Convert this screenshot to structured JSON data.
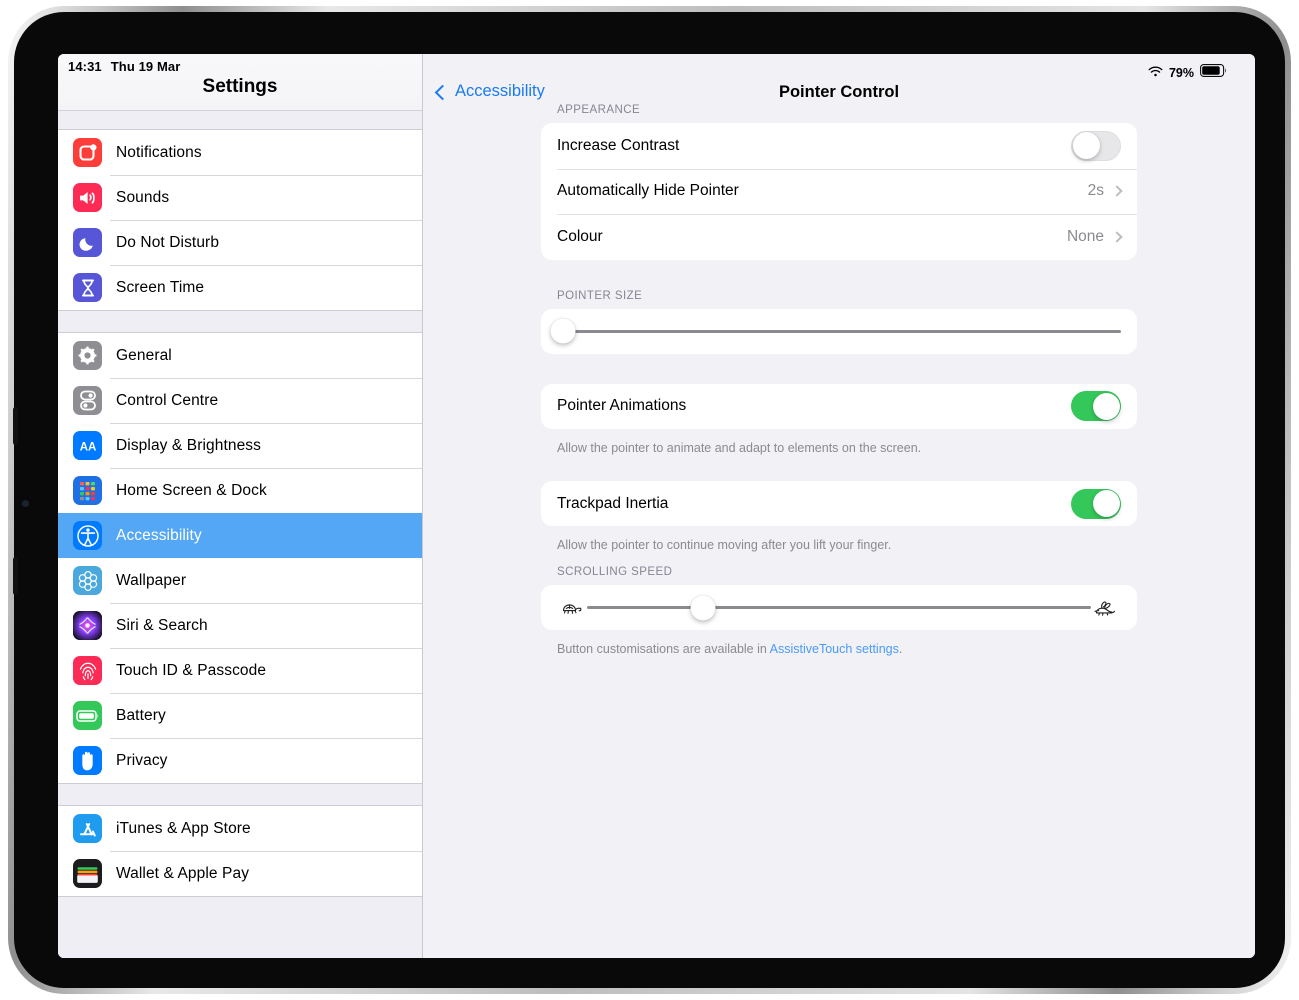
{
  "status_bar": {
    "time": "14:31",
    "date": "Thu 19 Mar",
    "battery_percent": "79%",
    "wifi_icon": "wifi-icon",
    "battery_icon": "battery-icon"
  },
  "sidebar": {
    "title": "Settings",
    "groups": [
      {
        "items": [
          {
            "label": "Notifications",
            "icon": "notifications-icon",
            "color": "#fc3d39",
            "selected": false
          },
          {
            "label": "Sounds",
            "icon": "sounds-icon",
            "color": "#fc2b55",
            "selected": false
          },
          {
            "label": "Do Not Disturb",
            "icon": "do-not-disturb-icon",
            "color": "#5756d6",
            "selected": false
          },
          {
            "label": "Screen Time",
            "icon": "screen-time-icon",
            "color": "#5756d6",
            "selected": false
          }
        ]
      },
      {
        "items": [
          {
            "label": "General",
            "icon": "general-gear-icon",
            "color": "#8e8e93",
            "selected": false
          },
          {
            "label": "Control Centre",
            "icon": "control-centre-icon",
            "color": "#8e8e93",
            "selected": false
          },
          {
            "label": "Display & Brightness",
            "icon": "display-brightness-icon",
            "color": "#007aff",
            "selected": false
          },
          {
            "label": "Home Screen & Dock",
            "icon": "home-screen-dock-icon",
            "color": "#1f6fe5",
            "selected": false
          },
          {
            "label": "Accessibility",
            "icon": "accessibility-icon",
            "color": "#007aff",
            "selected": true
          },
          {
            "label": "Wallpaper",
            "icon": "wallpaper-icon",
            "color": "#4aa8dd",
            "selected": false
          },
          {
            "label": "Siri & Search",
            "icon": "siri-search-icon",
            "color": "#2b1d3a",
            "selected": false
          },
          {
            "label": "Touch ID & Passcode",
            "icon": "touch-id-passcode-icon",
            "color": "#fc2b55",
            "selected": false
          },
          {
            "label": "Battery",
            "icon": "battery-settings-icon",
            "color": "#34c759",
            "selected": false
          },
          {
            "label": "Privacy",
            "icon": "privacy-hand-icon",
            "color": "#007aff",
            "selected": false
          }
        ]
      },
      {
        "items": [
          {
            "label": "iTunes & App Store",
            "icon": "app-store-icon",
            "color": "#1f9bf0",
            "selected": false
          },
          {
            "label": "Wallet & Apple Pay",
            "icon": "wallet-apple-pay-icon",
            "color": "#1c1c1e",
            "selected": false
          }
        ]
      }
    ]
  },
  "detail": {
    "back_label": "Accessibility",
    "title": "Pointer Control",
    "appearance": {
      "header": "APPEARANCE",
      "rows": [
        {
          "label": "Increase Contrast",
          "type": "toggle",
          "value": "off"
        },
        {
          "label": "Automatically Hide Pointer",
          "type": "disclosure",
          "value": "2s"
        },
        {
          "label": "Colour",
          "type": "disclosure",
          "value": "None"
        }
      ]
    },
    "pointer_size": {
      "header": "POINTER SIZE",
      "value_percent": 1
    },
    "pointer_animations": {
      "label": "Pointer Animations",
      "value": "on",
      "footnote": "Allow the pointer to animate and adapt to elements on the screen."
    },
    "trackpad_inertia": {
      "label": "Trackpad Inertia",
      "value": "on",
      "footnote": "Allow the pointer to continue moving after you lift your finger."
    },
    "scrolling_speed": {
      "header": "SCROLLING SPEED",
      "value_percent": 23,
      "slow_icon": "tortoise-icon",
      "fast_icon": "hare-icon"
    },
    "footer": {
      "text_before": "Button customisations are available in ",
      "link_text": "AssistiveTouch settings",
      "text_after": "."
    }
  },
  "colors": {
    "accent": "#007aff",
    "selected_row": "#54a7f5",
    "toggle_on": "#34c759",
    "pane_background": "#f2f1f6"
  }
}
